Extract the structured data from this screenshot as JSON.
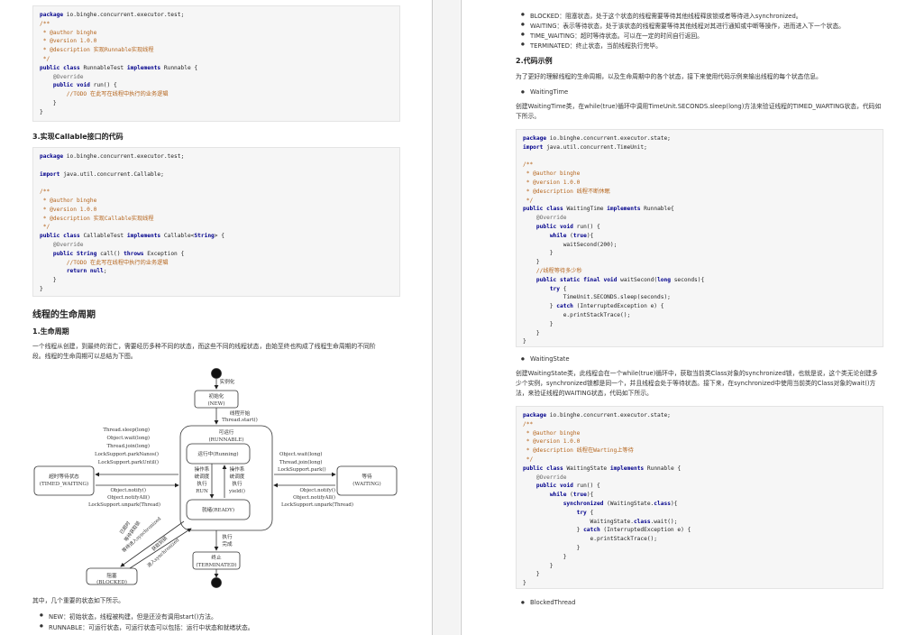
{
  "left": {
    "code1": [
      "package io.binghe.concurrent.executor.test;",
      "/**",
      " * @author binghe",
      " * @version 1.0.0",
      " * @description 实现Runnable实现线程",
      " */",
      "public class RunnableTest implements Runnable {",
      "    @Override",
      "    public void run() {",
      "        //TODO 在此写在线程中执行的业务逻辑",
      "    }",
      "}"
    ],
    "heading_callable": "3.实现Callable接口的代码",
    "code2": [
      "package io.binghe.concurrent.executor.test;",
      "",
      "import java.util.concurrent.Callable;",
      "",
      "/**",
      " * @author binghe",
      " * @version 1.0.0",
      " * @description 实现Callable实现线程",
      " */",
      "public class CallableTest implements Callable<String> {",
      "    @Override",
      "    public String call() throws Exception {",
      "        //TODO 在此写在线程中执行的业务逻辑",
      "        return null;",
      "    }",
      "}"
    ],
    "heading_lifecycle": "线程的生命周期",
    "heading_lifecycle_sub": "1.生命周期",
    "paragraph_lifecycle": [
      "一个线程从创建，到最终的消亡，需要经历多种不同的状态，而这些不同的线程状态，由始至终也构成了线程生命周期的不同阶",
      "段。线程的生命周期可以总结为下图。"
    ],
    "diagram": {
      "instantiate": "实例化",
      "new_state": [
        "初始化",
        "(NEW)"
      ],
      "thread_start": [
        "线程开始",
        "Thread.start()"
      ],
      "runnable_state": [
        "可运行",
        "(RUNNABLE)"
      ],
      "running": "运行中(Running)",
      "ready": "就绪(READY)",
      "scheduled_left": [
        "操作系",
        "统调度",
        "执行",
        "RUN"
      ],
      "scheduled_right": [
        "操作系",
        "统调度",
        "执行",
        "yield()"
      ],
      "timed_waiting": [
        "超时等待状态",
        "(TIMED_WAITING)"
      ],
      "timed_waiting_calls": [
        "Thread.sleep(long)",
        "Object.wait(long)",
        "Thread.join(long)",
        "LockSupport.parkNanos()",
        "LockSupport.parkUntil()"
      ],
      "notify_left": [
        "Object.notify()",
        "Object.notifyAll()",
        "LockSupport.unpark(Thread)"
      ],
      "waiting": [
        "等待",
        "(WAITING)"
      ],
      "waiting_calls": [
        "Object.wait(long)",
        "Thread.join(long)",
        "LockSupport.park()"
      ],
      "notify_right": [
        "Object.notify()",
        "Object.notifyAll()",
        "LockSupport.unpark(Thread)"
      ],
      "blocked": [
        "阻塞",
        "(BLOCKED)"
      ],
      "blocked_label_in": [
        "已超时",
        "等待获取锁",
        "等待进入synchronized"
      ],
      "blocked_label_out": [
        "获取到锁",
        "进入synchronized"
      ],
      "exec_done": [
        "执行",
        "完成"
      ],
      "terminated": [
        "终止",
        "(TERMINATED)"
      ]
    },
    "paragraph_states": "其中，几个重要的状态如下所示。",
    "bullets": [
      "NEW：初始状态，线程被构建，但是还没有调用start()方法。",
      "RUNNABLE：可运行状态，可运行状态可以包括：运行中状态和就绪状态。"
    ]
  },
  "right": {
    "bullets_top": [
      "BLOCKED：阻塞状态，处于这个状态的线程需要等待其他线程释放锁或者等待进入synchronized。",
      "WAITING：表示等待状态，处于该状态的线程需要等待其他线程对其进行通知或中断等操作，进而进入下一个状态。",
      "TIME_WAITING：超时等待状态。可以在一定的时间自行返回。",
      "TERMINATED：终止状态，当前线程执行完毕。"
    ],
    "heading_example": "2.代码示例",
    "paragraph_example": "为了更好的理解线程的生命周期，以及生命周期中的各个状态，接下来使用代码示例来输出线程的每个状态信息。",
    "bullet_waitingtime": "WaitingTime",
    "paragraph_waitingtime": [
      "创建WaitingTime类，在while(true)循环中调用TimeUnit.SECONDS.sleep(long)方法来验证线程的TIMED_WARTING状态，代码如",
      "下所示。"
    ],
    "code_waitingtime": [
      "package io.binghe.concurrent.executor.state;",
      "import java.util.concurrent.TimeUnit;",
      "",
      "/**",
      " * @author binghe",
      " * @version 1.0.0",
      " * @description 线程不断休眠",
      " */",
      "public class WaitingTime implements Runnable{",
      "    @Override",
      "    public void run() {",
      "        while (true){",
      "            waitSecond(200);",
      "        }",
      "    }",
      "    //线程等待多少秒",
      "    public static final void waitSecond(long seconds){",
      "        try {",
      "            TimeUnit.SECONDS.sleep(seconds);",
      "        } catch (InterruptedException e) {",
      "            e.printStackTrace();",
      "        }",
      "    }",
      "}"
    ],
    "bullet_waitingstate": "WaitingState",
    "paragraph_waitingstate": [
      "创建WaitingState类，此线程会在一个while(true)循环中，获取当前类Class对象的synchronized锁，也就是说，这个类无论创建多",
      "少个实例，synchronized锁都是同一个，并且线程会处于等待状态。接下来，在synchronized中使用当前类的Class对象的wait()方",
      "法，来验证线程的WAITING状态，代码如下所示。"
    ],
    "code_waitingstate": [
      "package io.binghe.concurrent.executor.state;",
      "/**",
      " * @author binghe",
      " * @version 1.0.0",
      " * @description 线程在Warting上等待",
      " */",
      "public class WaitingState implements Runnable {",
      "    @Override",
      "    public void run() {",
      "        while (true){",
      "            synchronized (WaitingState.class){",
      "                try {",
      "                    WaitingState.class.wait();",
      "                } catch (InterruptedException e) {",
      "                    e.printStackTrace();",
      "                }",
      "            }",
      "        }",
      "    }",
      "}"
    ],
    "bullet_blockedthread": "BlockedThread"
  }
}
